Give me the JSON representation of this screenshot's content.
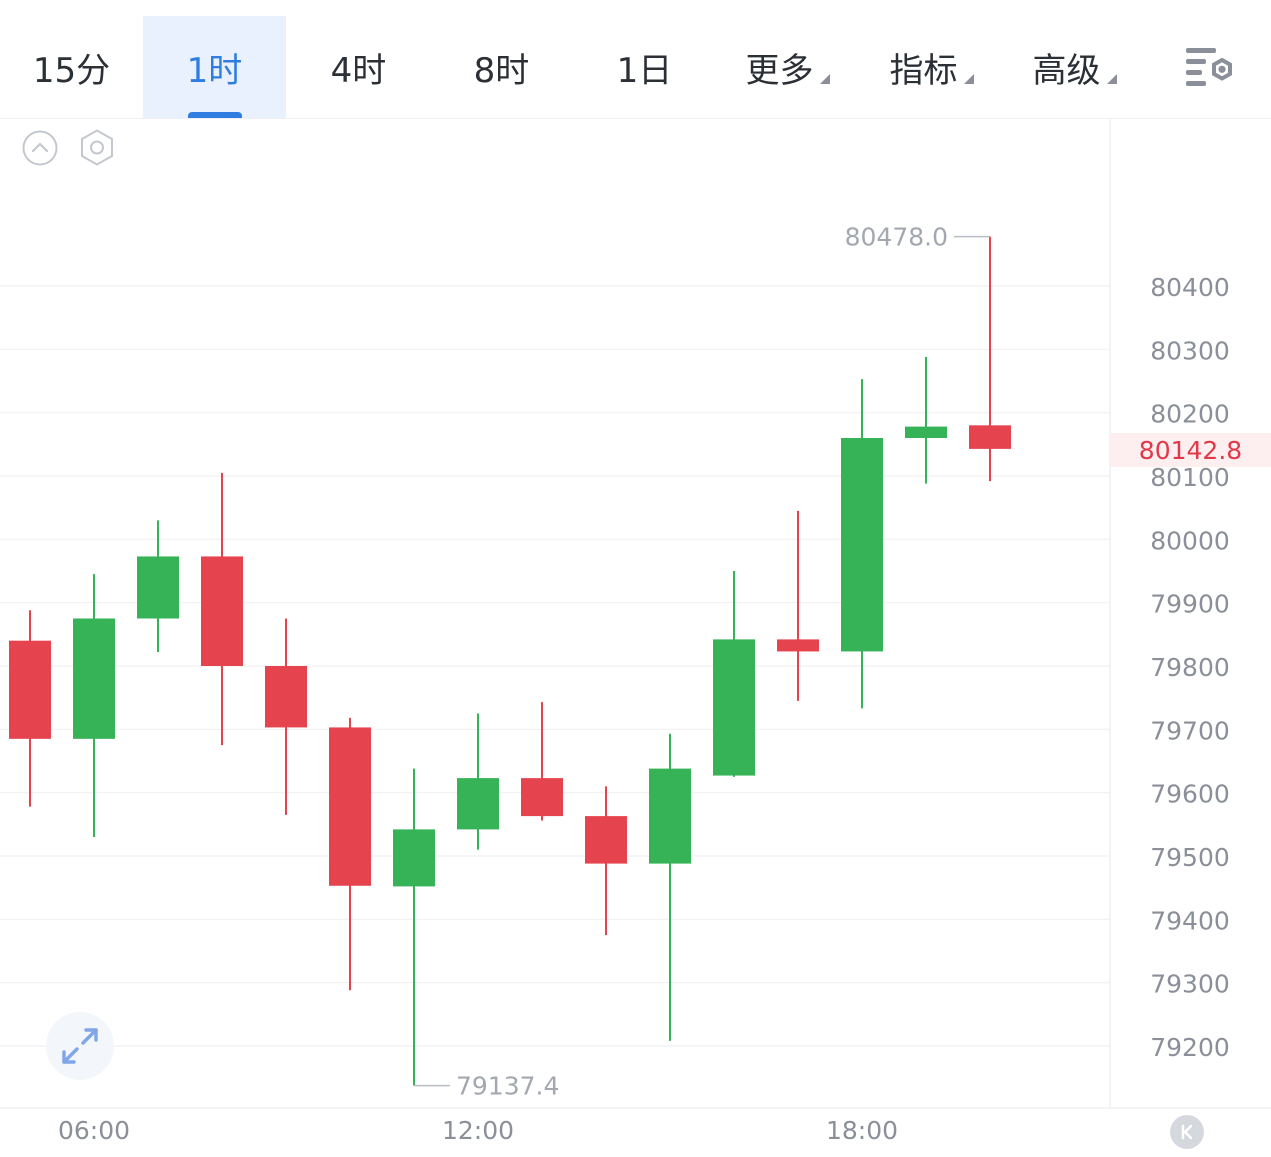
{
  "tabs": [
    {
      "label": "15分",
      "active": false,
      "dropdown": false
    },
    {
      "label": "1时",
      "active": true,
      "dropdown": false
    },
    {
      "label": "4时",
      "active": false,
      "dropdown": false
    },
    {
      "label": "8时",
      "active": false,
      "dropdown": false
    },
    {
      "label": "1日",
      "active": false,
      "dropdown": false
    },
    {
      "label": "更多",
      "active": false,
      "dropdown": true
    },
    {
      "label": "指标",
      "active": false,
      "dropdown": true
    },
    {
      "label": "高级",
      "active": false,
      "dropdown": true
    }
  ],
  "icons": {
    "settings": "chart-settings-icon",
    "collapse": "chevron-up-circle-icon",
    "gear": "hexagon-gear-icon",
    "expand": "expand-arrows-icon",
    "back": "skip-to-latest-icon"
  },
  "current_price": "80142.8",
  "colors": {
    "up": "#36b257",
    "down": "#e5444f",
    "accent": "#2f7de1",
    "current_price": "#e03a4a"
  },
  "chart_data": {
    "type": "candlestick",
    "x_tick_labels": [
      "06:00",
      "12:00",
      "18:00"
    ],
    "y_ticks": [
      80400,
      80300,
      80200,
      80100,
      80000,
      79900,
      79800,
      79700,
      79600,
      79500,
      79400,
      79300,
      79200
    ],
    "ylim": [
      79110,
      80560
    ],
    "grid": true,
    "max_label": "80478.0",
    "min_label": "79137.4",
    "candles": [
      {
        "open": 79840,
        "close": 79685,
        "high": 79888,
        "low": 79578
      },
      {
        "open": 79685,
        "close": 79875,
        "high": 79945,
        "low": 79530
      },
      {
        "open": 79875,
        "close": 79973,
        "high": 80030,
        "low": 79822
      },
      {
        "open": 79973,
        "close": 79800,
        "high": 80105,
        "low": 79675
      },
      {
        "open": 79800,
        "close": 79703,
        "high": 79875,
        "low": 79565
      },
      {
        "open": 79703,
        "close": 79453,
        "high": 79718,
        "low": 79288
      },
      {
        "open": 79452,
        "close": 79542,
        "high": 79638,
        "low": 79137.4
      },
      {
        "open": 79542,
        "close": 79623,
        "high": 79725,
        "low": 79510
      },
      {
        "open": 79623,
        "close": 79563,
        "high": 79743,
        "low": 79556
      },
      {
        "open": 79563,
        "close": 79488,
        "high": 79610,
        "low": 79375
      },
      {
        "open": 79488,
        "close": 79638,
        "high": 79693,
        "low": 79208
      },
      {
        "open": 79627,
        "close": 79842,
        "high": 79950,
        "low": 79625
      },
      {
        "open": 79842,
        "close": 79823,
        "high": 80045,
        "low": 79745
      },
      {
        "open": 79823,
        "close": 80160,
        "high": 80253,
        "low": 79733
      },
      {
        "open": 80160,
        "close": 80178,
        "high": 80288,
        "low": 80088
      },
      {
        "open": 80180,
        "close": 80142.8,
        "high": 80478.0,
        "low": 80092
      }
    ]
  }
}
